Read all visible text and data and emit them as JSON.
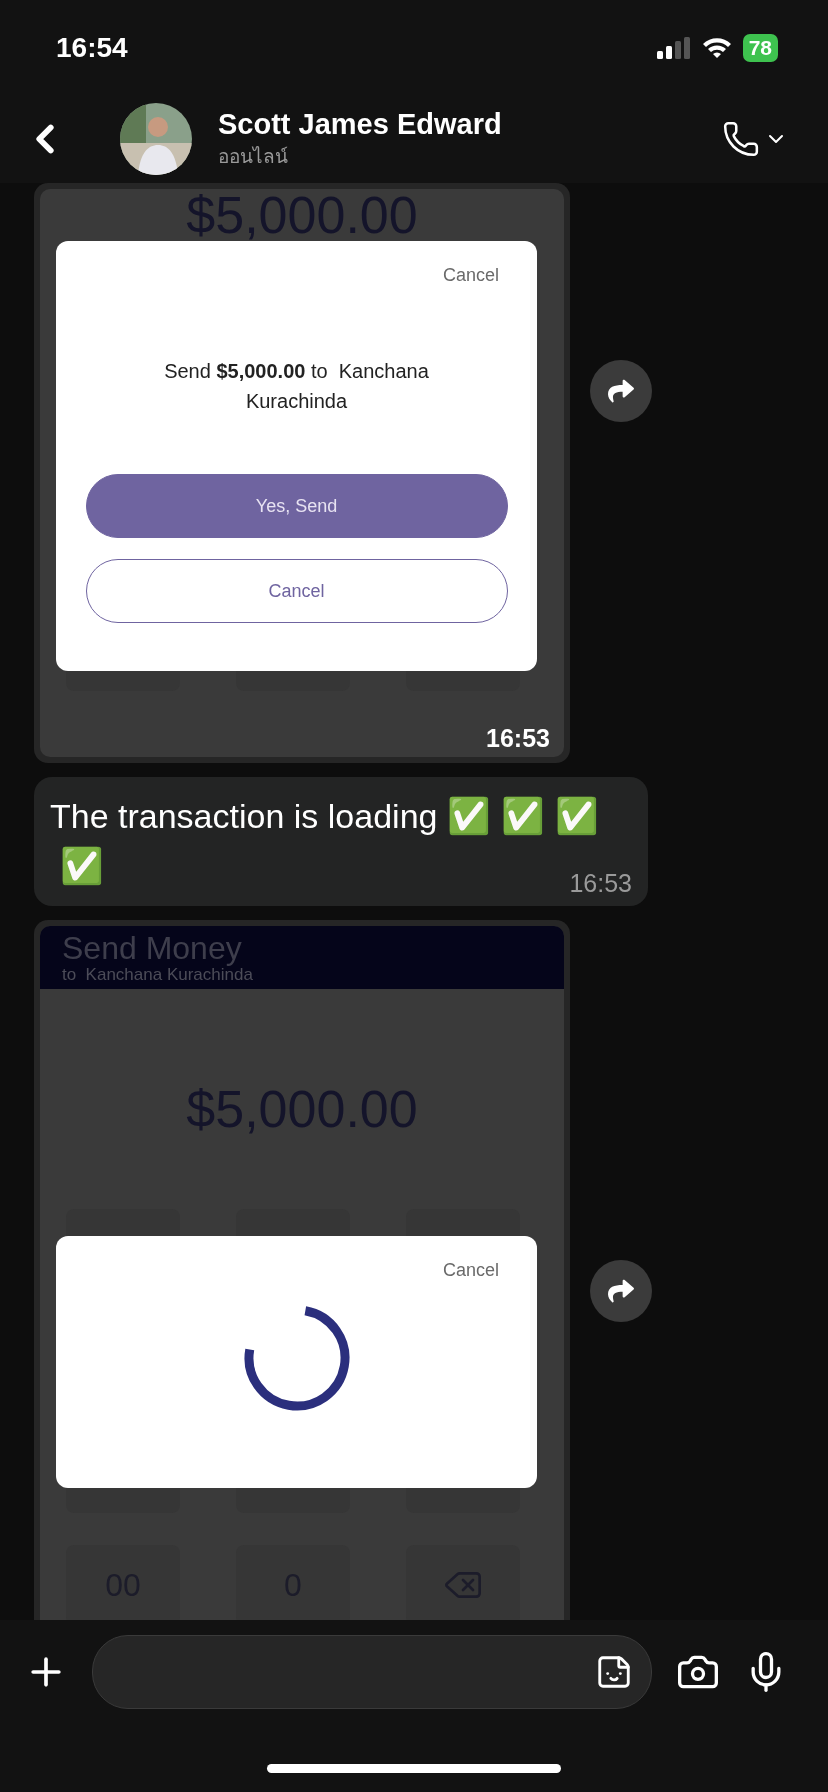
{
  "status_bar": {
    "time": "16:54",
    "battery": "78"
  },
  "header": {
    "contact_name": "Scott James Edward",
    "presence": "ออนไลน์"
  },
  "messages": [
    {
      "time": "16:53",
      "screenshot": {
        "amount": "$5,000.00",
        "dialog": {
          "kind": "confirm",
          "cancel_link": "Cancel",
          "message": "Send **$5,000.00** to  Kanchana Kurachinda",
          "confirm_button": "Yes, Send",
          "cancel_button": "Cancel"
        }
      }
    },
    {
      "kind": "text",
      "time": "16:53",
      "text": "The transaction is loading",
      "emojis": [
        "✅",
        "✅",
        "✅",
        "✅"
      ]
    },
    {
      "screenshot": {
        "title": "Send Money",
        "recipient": "to  Kanchana Kurachinda",
        "amount": "$5,000.00",
        "keys": [
          "00",
          "0"
        ],
        "dialog": {
          "kind": "loading",
          "cancel_link": "Cancel"
        }
      }
    }
  ]
}
